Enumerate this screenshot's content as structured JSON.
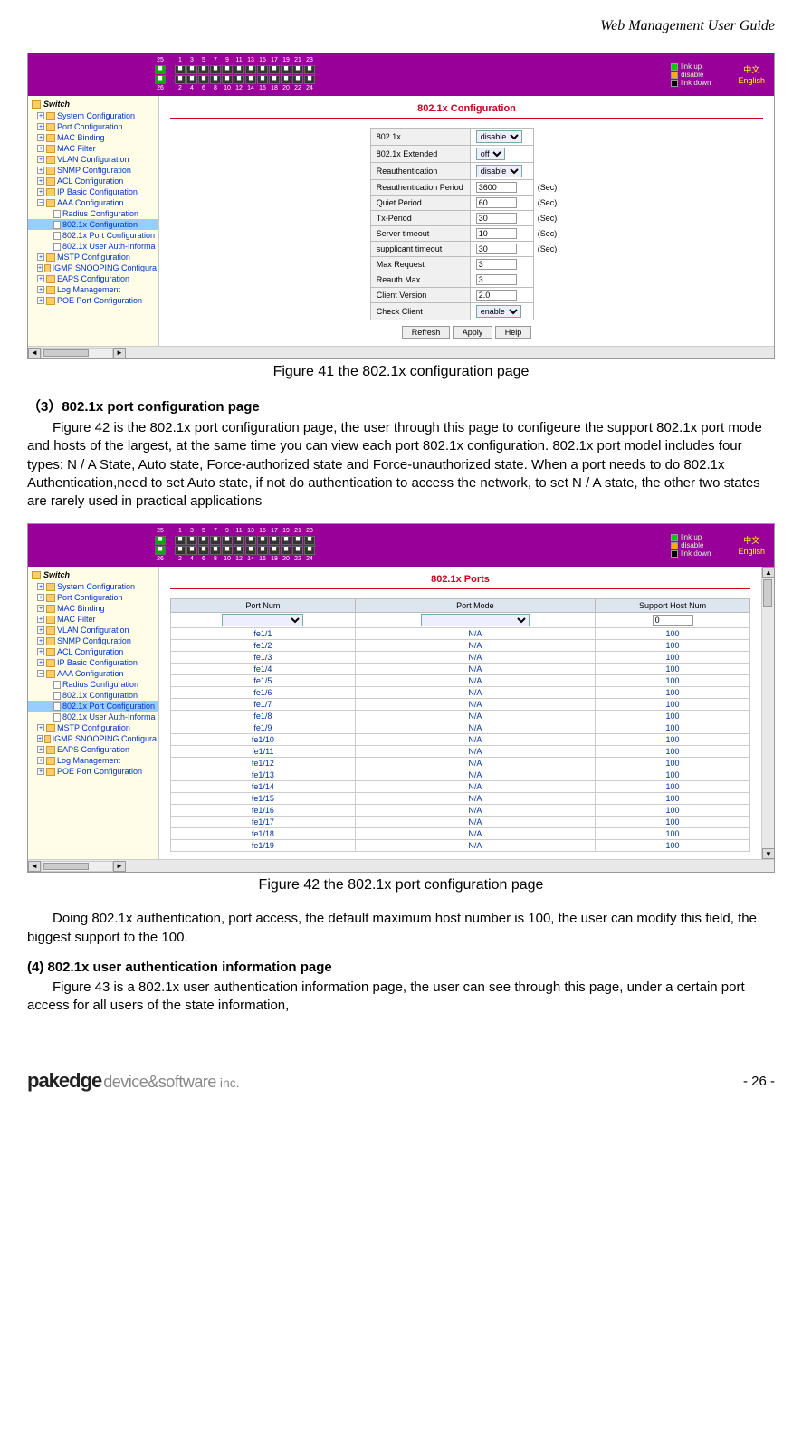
{
  "header": {
    "title": "Web Management User Guide"
  },
  "topbar": {
    "port_labels_top": [
      "25",
      "1",
      "3",
      "5",
      "7",
      "9",
      "11",
      "13",
      "15",
      "17",
      "19",
      "21",
      "23"
    ],
    "port_labels_bottom": [
      "26",
      "2",
      "4",
      "6",
      "8",
      "10",
      "12",
      "14",
      "16",
      "18",
      "20",
      "22",
      "24"
    ],
    "legend": {
      "up": "link up",
      "disable": "disable",
      "down": "link down"
    },
    "lang_cn": "中文",
    "lang_en": "English"
  },
  "sidebar": {
    "root": "Switch",
    "items": [
      "System Configuration",
      "Port Configuration",
      "MAC Binding",
      "MAC Filter",
      "VLAN Configuration",
      "SNMP Configuration",
      "ACL Configuration",
      "IP Basic Configuration",
      "AAA Configuration"
    ],
    "aaa_children": [
      "Radius Configuration",
      "802.1x Configuration",
      "802.1x Port Configuration",
      "802.1x User Auth-Informa"
    ],
    "items_after": [
      "MSTP Configuration",
      "IGMP SNOOPING Configura",
      "EAPS Configuration",
      "Log Management",
      "POE Port Configuration"
    ]
  },
  "fig41": {
    "title": "802.1x Configuration",
    "rows": [
      {
        "label": "802.1x",
        "value": "disable",
        "type": "select"
      },
      {
        "label": "802.1x Extended",
        "value": "off",
        "type": "select"
      },
      {
        "label": "Reauthentication",
        "value": "disable",
        "type": "select"
      },
      {
        "label": "Reauthentication Period",
        "value": "3600",
        "type": "input",
        "unit": "(Sec)"
      },
      {
        "label": "Quiet Period",
        "value": "60",
        "type": "input",
        "unit": "(Sec)"
      },
      {
        "label": "Tx-Period",
        "value": "30",
        "type": "input",
        "unit": "(Sec)"
      },
      {
        "label": "Server timeout",
        "value": "10",
        "type": "input",
        "unit": "(Sec)"
      },
      {
        "label": "supplicant timeout",
        "value": "30",
        "type": "input",
        "unit": "(Sec)"
      },
      {
        "label": "Max Request",
        "value": "3",
        "type": "input"
      },
      {
        "label": "Reauth Max",
        "value": "3",
        "type": "input"
      },
      {
        "label": "Client Version",
        "value": "2.0",
        "type": "input"
      },
      {
        "label": "Check Client",
        "value": "enable",
        "type": "select"
      }
    ],
    "buttons": {
      "refresh": "Refresh",
      "apply": "Apply",
      "help": "Help"
    },
    "caption": "Figure 41 the 802.1x configuration page"
  },
  "section3": {
    "heading": "（3）802.1x port configuration page",
    "body": "Figure 42 is the 802.1x port configuration page, the user through this page to configeure the support 802.1x port mode and hosts of the largest, at the same time you can view each port 802.1x configuration. 802.1x port model includes four types: N / A State, Auto state, Force-authorized state and Force-unauthorized state. When a port needs to do 802.1x Authentication,need to set Auto state, if not do authentication to access the network, to set N / A state, the other two states are rarely used in practical applications"
  },
  "fig42": {
    "title": "802.1x Ports",
    "headers": [
      "Port Num",
      "Port Mode",
      "Support Host Num"
    ],
    "input_row_host": "0",
    "rows": [
      {
        "port": "fe1/1",
        "mode": "N/A",
        "host": "100"
      },
      {
        "port": "fe1/2",
        "mode": "N/A",
        "host": "100"
      },
      {
        "port": "fe1/3",
        "mode": "N/A",
        "host": "100"
      },
      {
        "port": "fe1/4",
        "mode": "N/A",
        "host": "100"
      },
      {
        "port": "fe1/5",
        "mode": "N/A",
        "host": "100"
      },
      {
        "port": "fe1/6",
        "mode": "N/A",
        "host": "100"
      },
      {
        "port": "fe1/7",
        "mode": "N/A",
        "host": "100"
      },
      {
        "port": "fe1/8",
        "mode": "N/A",
        "host": "100"
      },
      {
        "port": "fe1/9",
        "mode": "N/A",
        "host": "100"
      },
      {
        "port": "fe1/10",
        "mode": "N/A",
        "host": "100"
      },
      {
        "port": "fe1/11",
        "mode": "N/A",
        "host": "100"
      },
      {
        "port": "fe1/12",
        "mode": "N/A",
        "host": "100"
      },
      {
        "port": "fe1/13",
        "mode": "N/A",
        "host": "100"
      },
      {
        "port": "fe1/14",
        "mode": "N/A",
        "host": "100"
      },
      {
        "port": "fe1/15",
        "mode": "N/A",
        "host": "100"
      },
      {
        "port": "fe1/16",
        "mode": "N/A",
        "host": "100"
      },
      {
        "port": "fe1/17",
        "mode": "N/A",
        "host": "100"
      },
      {
        "port": "fe1/18",
        "mode": "N/A",
        "host": "100"
      },
      {
        "port": "fe1/19",
        "mode": "N/A",
        "host": "100"
      }
    ],
    "caption": "Figure 42 the 802.1x port configuration page"
  },
  "body_after_42": "Doing 802.1x authentication, port access, the default maximum host number is 100, the user can modify this field, the biggest support to the 100.",
  "section4": {
    "heading": "(4) 802.1x user authentication information page",
    "body": "Figure 43 is a 802.1x user authentication information page, the user can see through this page, under a certain port access for all users of the state information,"
  },
  "footer": {
    "logo_main": "pakedge",
    "logo_sub": "device&software",
    "logo_inc": "inc.",
    "page": "- 26 -"
  }
}
